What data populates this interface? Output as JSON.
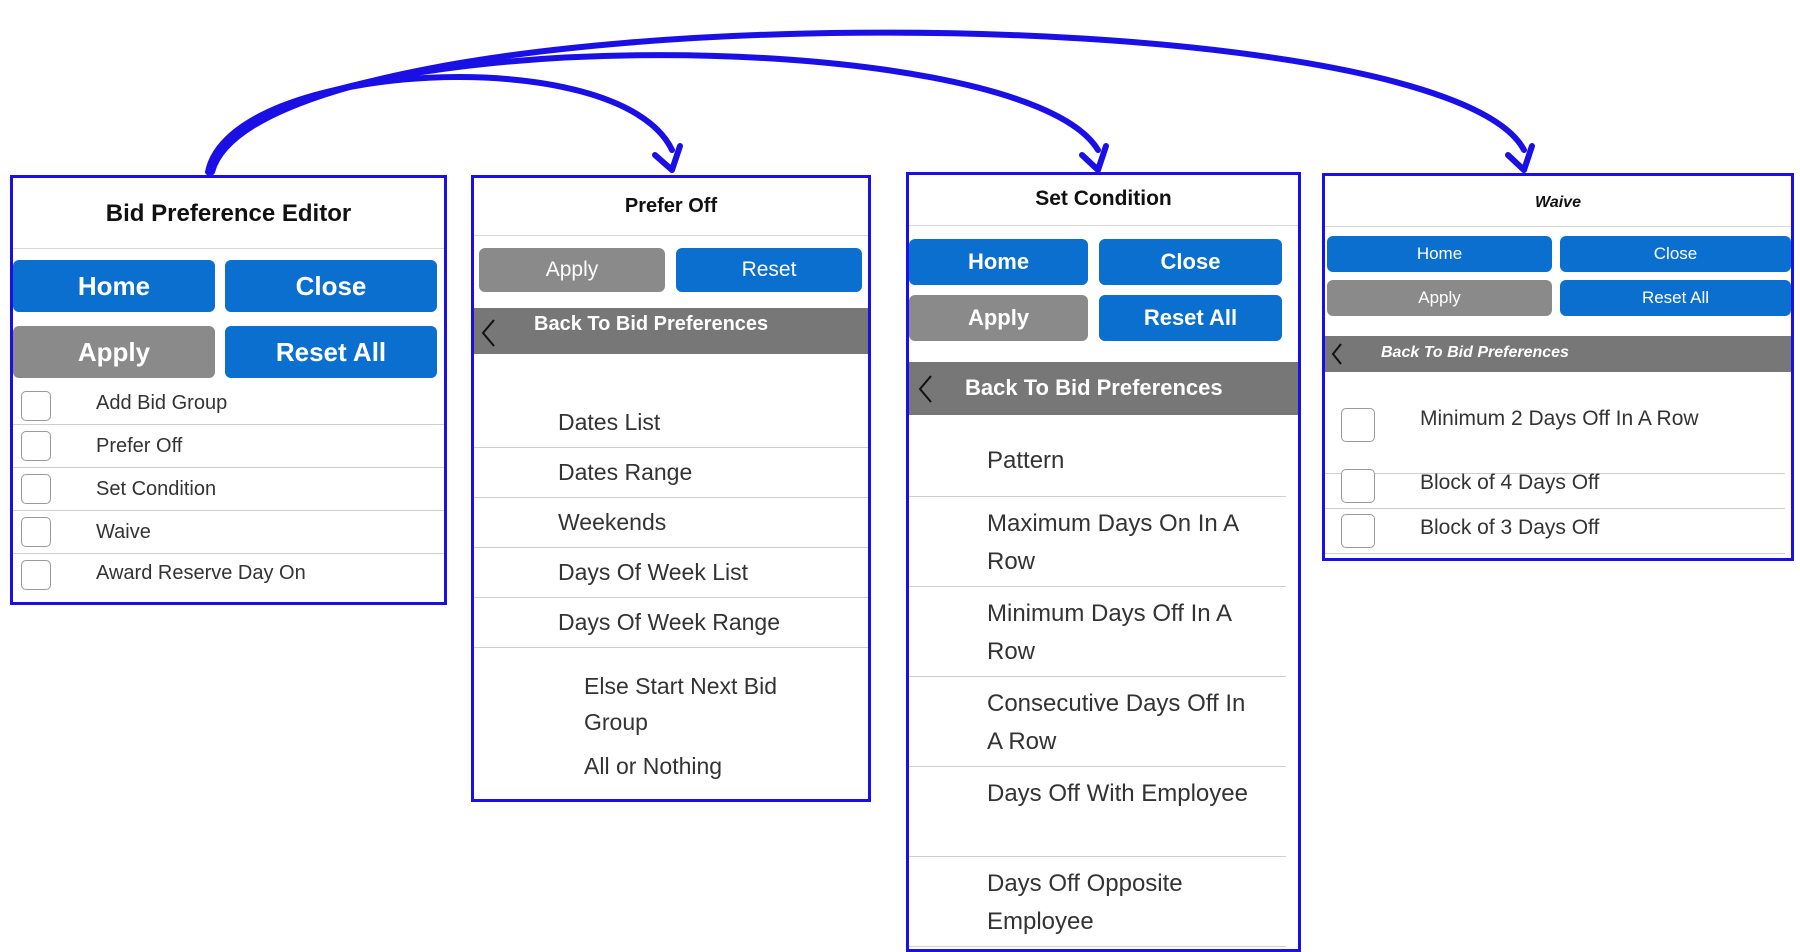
{
  "colors": {
    "frame": "#1a10e6",
    "button_blue": "#0b6fd0",
    "button_grey": "#8a8a8a",
    "back_bar": "#777777"
  },
  "editor": {
    "title": "Bid Preference Editor",
    "home": "Home",
    "close": "Close",
    "apply": "Apply",
    "reset_all": "Reset All",
    "items": [
      "Add Bid Group",
      "Prefer Off",
      "Set Condition",
      "Waive",
      "Award Reserve Day On"
    ]
  },
  "prefer_off": {
    "title": "Prefer Off",
    "apply": "Apply",
    "reset": "Reset",
    "back": "Back To Bid Preferences",
    "items": [
      "Dates List",
      "Dates Range",
      "Weekends",
      "Days Of Week List",
      "Days Of Week Range"
    ],
    "sub_items": [
      "Else Start Next Bid Group",
      "All or Nothing"
    ]
  },
  "set_condition": {
    "title": "Set Condition",
    "home": "Home",
    "close": "Close",
    "apply": "Apply",
    "reset_all": "Reset All",
    "back": "Back To Bid Preferences",
    "items": [
      "Pattern",
      "Maximum Days On In A Row",
      "Minimum Days Off In A Row",
      "Consecutive Days Off In A Row",
      "Days Off With Employee",
      "Days Off Opposite Employee"
    ]
  },
  "waive": {
    "title": "Waive",
    "home": "Home",
    "close": "Close",
    "apply": "Apply",
    "reset_all": "Reset All",
    "back": "Back To Bid Preferences",
    "items": [
      "Minimum 2 Days Off In A Row",
      "Block of 4 Days Off",
      "Block of 3 Days Off"
    ]
  }
}
